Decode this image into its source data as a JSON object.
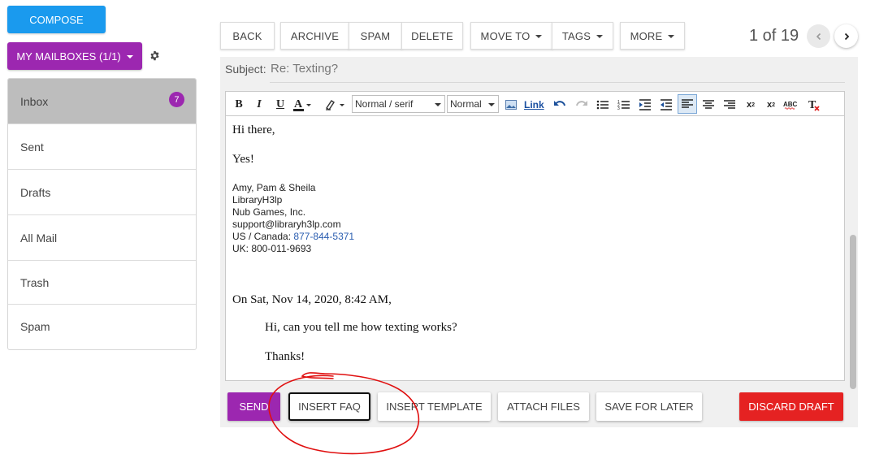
{
  "sidebar": {
    "compose_label": "COMPOSE",
    "mailboxes_label": "MY MAILBOXES (1/1)",
    "folders": [
      {
        "label": "Inbox",
        "badge": "7",
        "active": true
      },
      {
        "label": "Sent"
      },
      {
        "label": "Drafts"
      },
      {
        "label": "All Mail"
      },
      {
        "label": "Trash"
      },
      {
        "label": "Spam"
      }
    ]
  },
  "toolbar": {
    "back": "BACK",
    "archive": "ARCHIVE",
    "spam": "SPAM",
    "delete": "DELETE",
    "move_to": "MOVE TO",
    "tags": "TAGS",
    "more": "MORE",
    "pager": "1 of 19"
  },
  "compose": {
    "subject_label": "Subject:",
    "subject_value": "Re: Texting?",
    "editor": {
      "font_select": "Normal / serif",
      "size_select": "Normal",
      "link_label": "Link"
    },
    "body": {
      "greeting": "Hi there,",
      "reply": "Yes!",
      "signature": {
        "names": "Amy, Pam & Sheila",
        "org": "LibraryH3lp",
        "company": "Nub Games, Inc.",
        "email": "support@libraryh3lp.com",
        "us_prefix": "US / Canada: ",
        "us_phone": "877-844-5371",
        "uk": "UK: 800-011-9693"
      },
      "quote_header": "On Sat, Nov 14, 2020, 8:42 AM,",
      "quote_line1": "Hi, can you tell me how texting works?",
      "quote_line2": "Thanks!"
    },
    "actions": {
      "send": "SEND",
      "insert_faq": "INSERT FAQ",
      "insert_template": "INSERT TEMPLATE",
      "attach_files": "ATTACH FILES",
      "save_for_later": "SAVE FOR LATER",
      "discard_draft": "DISCARD DRAFT"
    }
  },
  "colors": {
    "compose_blue": "#1a9aee",
    "purple": "#9c27b0",
    "discard_red": "#e52222",
    "annotation_red": "#e01010"
  },
  "icons": [
    "gear-icon",
    "chevron-left-icon",
    "chevron-right-icon",
    "bold-icon",
    "italic-icon",
    "underline-icon",
    "text-color-icon",
    "highlight-icon",
    "image-icon",
    "undo-icon",
    "redo-icon",
    "bullet-list-icon",
    "numbered-list-icon",
    "indent-icon",
    "outdent-icon",
    "align-left-icon",
    "align-center-icon",
    "align-right-icon",
    "subscript-icon",
    "superscript-icon",
    "spellcheck-icon",
    "clear-format-icon"
  ]
}
